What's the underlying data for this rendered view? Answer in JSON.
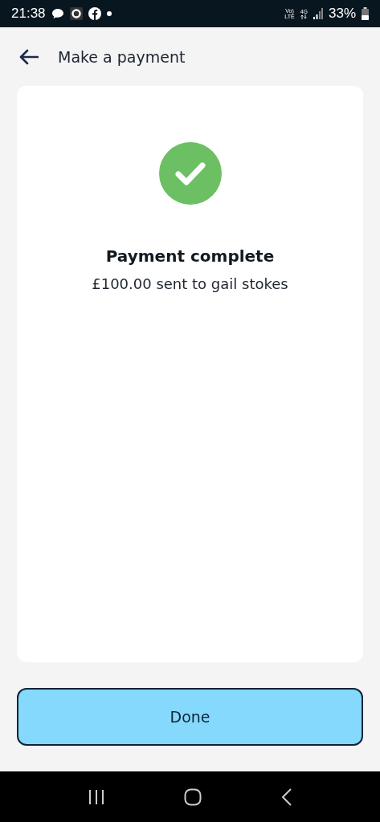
{
  "status_bar": {
    "time": "21:38",
    "volte_top": "Vo)",
    "volte_bottom": "LTE",
    "network": "4G",
    "battery": "33%"
  },
  "header": {
    "title": "Make a payment"
  },
  "result": {
    "kind": "success",
    "title": "Payment complete",
    "message": "£100.00 sent to gail stokes"
  },
  "done_button": {
    "label": "Done"
  }
}
